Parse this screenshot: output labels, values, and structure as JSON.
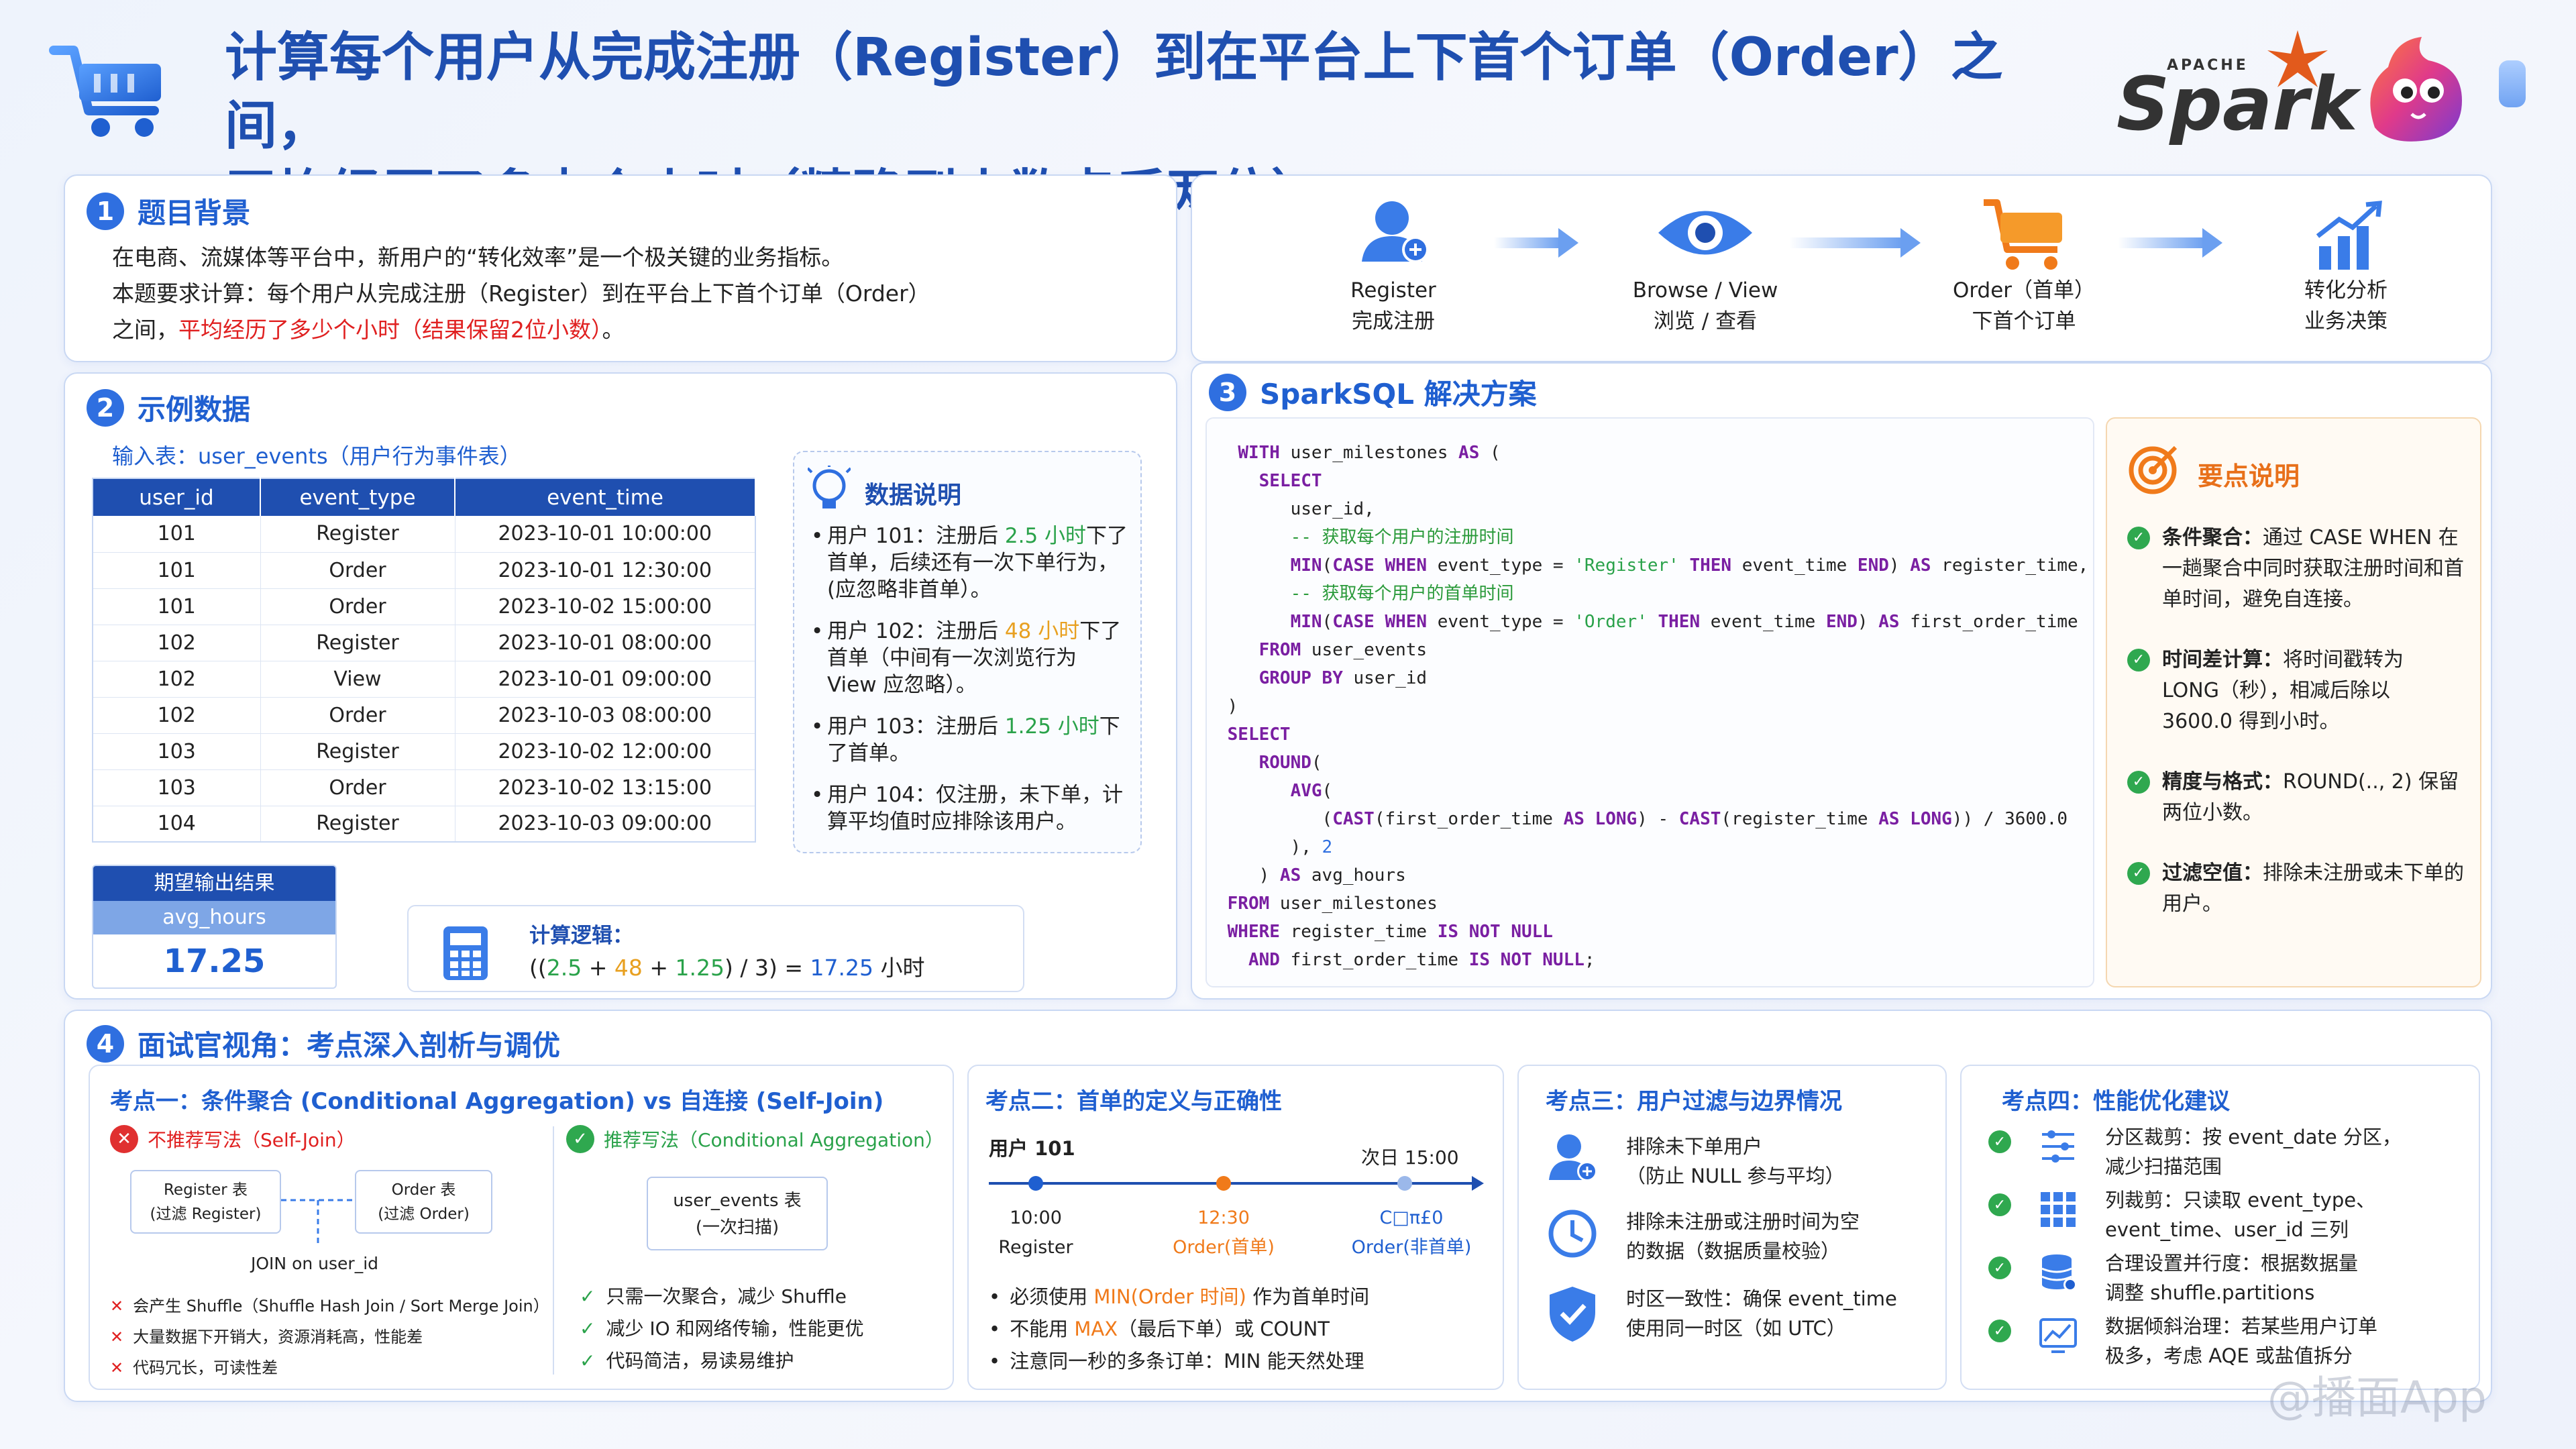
{
  "header": {
    "title_line1": "计算每个用户从完成注册（Register）到在平台上下首个订单（Order）之间，",
    "title_line2": "平均经历了多少个小时（精确到小数点后两位）",
    "logo_top": "APACHE",
    "logo_main": "Spark"
  },
  "sec1": {
    "num": "1",
    "title": "题目背景",
    "line1": "在电商、流媒体等平台中，新用户的“转化效率”是一个极关键的业务指标。",
    "line2": "本题要求计算：每个用户从完成注册（Register）到在平台上下首个订单（Order）",
    "line3a": "之间，",
    "line3b": "平均经历了多少个小时（结果保留2位小数）",
    "line3c": "。"
  },
  "flow": [
    {
      "en": "Register",
      "cn": "完成注册"
    },
    {
      "en": "Browse / View",
      "cn": "浏览 / 查看"
    },
    {
      "en": "Order（首单）",
      "cn": "下首个订单"
    },
    {
      "en": "转化分析",
      "cn": "业务决策"
    }
  ],
  "sec2": {
    "num": "2",
    "title": "示例数据",
    "input_label": "输入表：user_events（用户行为事件表）",
    "columns": [
      "user_id",
      "event_type",
      "event_time"
    ],
    "rows": [
      [
        "101",
        "Register",
        "2023-10-01 10:00:00"
      ],
      [
        "101",
        "Order",
        "2023-10-01 12:30:00"
      ],
      [
        "101",
        "Order",
        "2023-10-02 15:00:00"
      ],
      [
        "102",
        "Register",
        "2023-10-01 08:00:00"
      ],
      [
        "102",
        "View",
        "2023-10-01 09:00:00"
      ],
      [
        "102",
        "Order",
        "2023-10-03 08:00:00"
      ],
      [
        "103",
        "Register",
        "2023-10-02 12:00:00"
      ],
      [
        "103",
        "Order",
        "2023-10-02 13:15:00"
      ],
      [
        "104",
        "Register",
        "2023-10-03 09:00:00"
      ]
    ],
    "notes_title": "数据说明",
    "notes": [
      {
        "a": "用户 101：注册后 ",
        "b": "2.5 小时",
        "c": "下了首单，后续还有一次下单行为，(应忽略非首单）。",
        "color": "#2aa24a"
      },
      {
        "a": "用户 102：注册后 ",
        "b": "48 小时",
        "c": "下了首单（中间有一次浏览行为 View 应忽略）。",
        "color": "#e8a020"
      },
      {
        "a": "用户 103：注册后 ",
        "b": "1.25 小时",
        "c": "下了首单。",
        "color": "#2aa24a"
      },
      {
        "a": "用户 104：仅注册，未下单，计算平均值时应排除该用户。",
        "b": "",
        "c": "",
        "color": "#222"
      }
    ],
    "expected_title": "期望输出结果",
    "expected_col": "avg_hours",
    "expected_val": "17.25",
    "calc_title": "计算逻辑：",
    "calc_parts": [
      "((",
      "2.5",
      " + ",
      "48",
      " + ",
      "1.25",
      ") / 3) = ",
      "17.25",
      " 小时"
    ]
  },
  "sec3": {
    "num": "3",
    "title": "SparkSQL 解决方案",
    "points_title": "要点说明",
    "points": [
      {
        "bold": "条件聚合：",
        "text": "通过 CASE WHEN 在一趟聚合中同时获取注册时间和首单时间，避免自连接。"
      },
      {
        "bold": "时间差计算：",
        "text": "将时间戳转为 LONG（秒），相减后除以 3600.0 得到小时。"
      },
      {
        "bold": "精度与格式：",
        "text": "ROUND(.., 2) 保留两位小数。"
      },
      {
        "bold": "过滤空值：",
        "text": "排除未注册或未下单的用户。"
      }
    ]
  },
  "sec4": {
    "num": "4",
    "title": "面试官视角：考点深入剖析与调优",
    "k1": {
      "title": "考点一：条件聚合 (Conditional Aggregation) vs 自连接 (Self-Join)",
      "bad_title": "不推荐写法（Self-Join）",
      "box_reg": "Register 表\n(过滤 Register)",
      "box_ord": "Order 表\n(过滤 Order)",
      "join_label": "JOIN on user_id",
      "bad_points": [
        "会产生 Shuffle（Shuffle Hash Join / Sort Merge Join）",
        "大量数据下开销大，资源消耗高，性能差",
        "代码冗长，可读性差"
      ],
      "good_title": "推荐写法（Conditional Aggregation）",
      "box_ue": "user_events 表\n(一次扫描)",
      "good_points": [
        "只需一次聚合，减少 Shuffle",
        "减少 IO 和网络传输，性能更优",
        "代码简洁，易读易维护"
      ]
    },
    "k2": {
      "title": "考点二：首单的定义与正确性",
      "user": "用户 101",
      "next_day": "次日 15:00",
      "t1": "10:00",
      "t1b": "Register",
      "t2": "12:30",
      "t2b": "Order(首单)",
      "t3": "C□π£0",
      "t3b": "Order(非首单)",
      "bullets": [
        {
          "a": "必须使用 ",
          "b": "MIN(Order 时间)",
          "c": " 作为首单时间"
        },
        {
          "a": "不能用 ",
          "b": "MAX",
          "c": "（最后下单）或 COUNT"
        },
        {
          "a": "注意同一秒的多条订单：MIN 能天然处理",
          "b": "",
          "c": ""
        }
      ]
    },
    "k3": {
      "title": "考点三：用户过滤与边界情况",
      "items": [
        "排除未下单用户\n（防止 NULL 参与平均）",
        "排除未注册或注册时间为空\n的数据（数据质量校验）",
        "时区一致性：确保 event_time\n使用同一时区（如 UTC）"
      ]
    },
    "k4": {
      "title": "考点四：性能优化建议",
      "items": [
        "分区裁剪：按 event_date 分区，\n减少扫描范围",
        "列裁剪：只读取 event_type、\nevent_time、user_id 三列",
        "合理设置并行度：根据数据量\n调整 shuffle.partitions",
        "数据倾斜治理：若某些用户订单\n极多，考虑 AQE 或盐值拆分"
      ]
    }
  },
  "watermark": "@播面App"
}
